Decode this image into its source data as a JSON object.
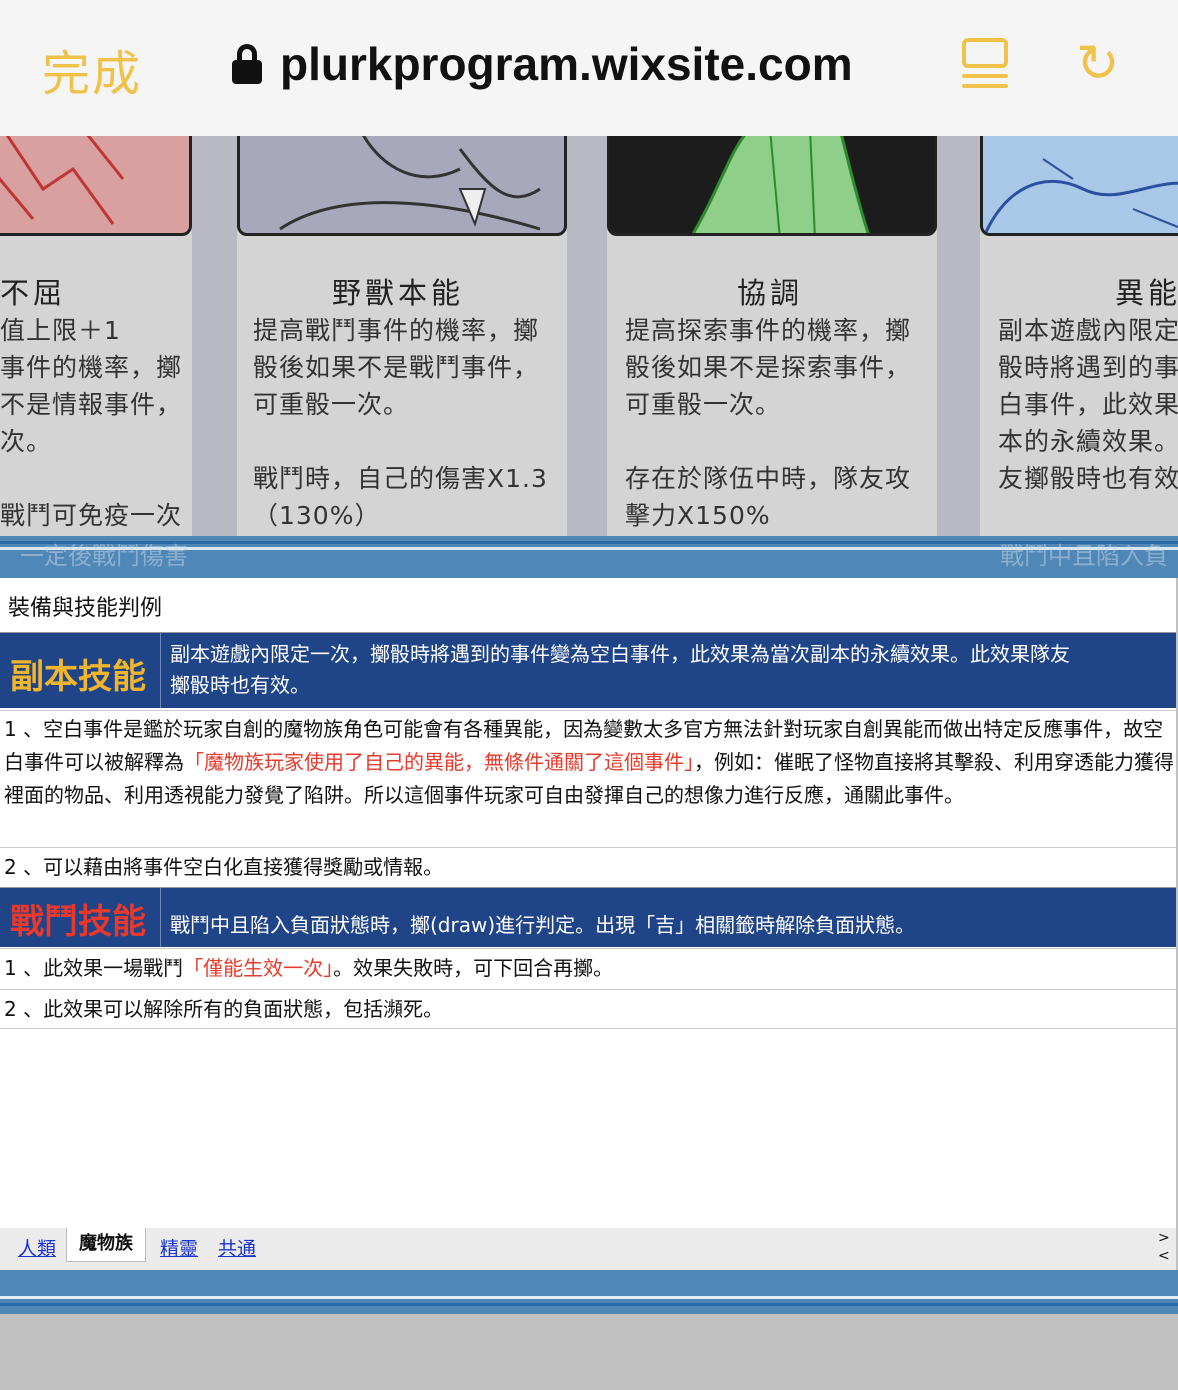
{
  "browser": {
    "done_label": "完成",
    "url": "plurkprogram.wixsite.com",
    "accent_color": "#f0c24a",
    "icons": [
      "lock-icon",
      "reader-icon",
      "reload-icon"
    ]
  },
  "cards": [
    {
      "title": "不屈",
      "desc": "值上限＋1\n事件的機率，擲\n不是情報事件，\n次。\n\n戰鬥可免疫一次"
    },
    {
      "title": "野獸本能",
      "desc": "提高戰鬥事件的機率，擲\n骰後如果不是戰鬥事件，\n可重骰一次。\n\n戰鬥時，自己的傷害X1.3\n（130%）"
    },
    {
      "title": "協調",
      "desc": "提高探索事件的機率，擲\n骰後如果不是探索事件，\n可重骰一次。\n\n存在於隊伍中時，隊友攻\n擊力X150%"
    },
    {
      "title": "異能",
      "desc": "副本遊戲內限定\n骰時將遇到的事\n白事件，此效果\n本的永續效果。\n友擲骰時也有效"
    }
  ],
  "band_ghost": {
    "left": "一定後戰鬥傷害",
    "right": "戰鬥中且陷入負"
  },
  "panel": {
    "title": "裝備與技能判例",
    "skill1": {
      "name": "副本技能",
      "desc_line1": "副本遊戲內限定一次，擲骰時將遇到的事件變為空白事件，此效果為當次副本的永續效果。此效果隊友",
      "desc_line2": "擲骰時也有效。",
      "rule1_prefix": "1 、空白事件是鑑於玩家自創的魔物族角色可能會有各種異能，因為變數太多官方無法針對玩家自創異能而做出特定反應事件，故空白事件可以被解釋為",
      "rule1_red": "「魔物族玩家使用了自己的異能，無條件通關了這個事件」",
      "rule1_suffix": "，例如：催眠了怪物直接將其擊殺、利用穿透能力獲得裡面的物品、利用透視能力發覺了陷阱。所以這個事件玩家可自由發揮自己的想像力進行反應，通關此事件。",
      "rule2": "2 、可以藉由將事件空白化直接獲得獎勵或情報。"
    },
    "skill2": {
      "name": "戰鬥技能",
      "desc": "戰鬥中且陷入負面狀態時，擲(draw)進行判定。出現「吉」相關籤時解除負面狀態。",
      "rule1_prefix": "1 、此效果一場戰鬥",
      "rule1_red": "「僅能生效一次」",
      "rule1_suffix": "。效果失敗時，可下回合再擲。",
      "rule2": "2 、此效果可以解除所有的負面狀態，包括瀕死。"
    }
  },
  "tabs": {
    "human": "人類",
    "monster": "魔物族",
    "elf": "精靈",
    "common": "共通",
    "next": ">",
    "prev": "<"
  },
  "colors": {
    "skill_bar": "#1f4487",
    "skill1_name": "#f3b52b",
    "skill2_name": "#e8392c",
    "highlight_red": "#e53b2c",
    "band": "#4f87b6"
  }
}
